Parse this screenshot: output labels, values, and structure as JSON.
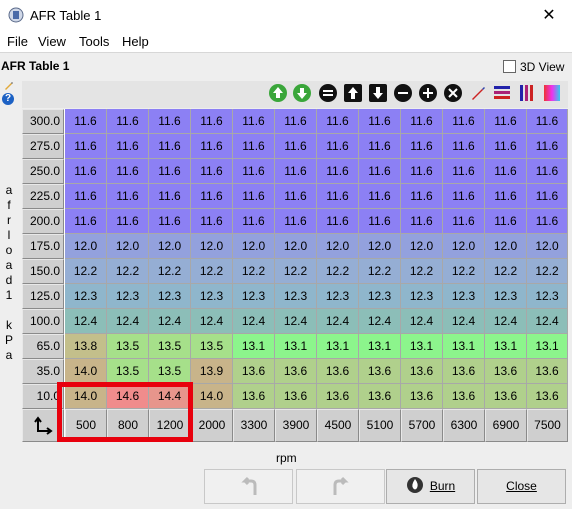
{
  "window": {
    "title": "AFR Table 1",
    "close_glyph": "✕",
    "icon": "wrench-app-icon"
  },
  "menu": [
    "File",
    "View",
    "Tools",
    "Help"
  ],
  "panel": {
    "title": "AFR Table 1",
    "threed_label": "3D View",
    "threed_checked": false
  },
  "toolbar_icons": [
    "green-up-arrow-icon",
    "green-down-arrow-icon",
    "equals-icon",
    "up-arrow-icon",
    "down-arrow-icon",
    "minus-icon",
    "plus-icon",
    "multiply-icon",
    "pencil-icon",
    "horizontal-gradient-icon",
    "vertical-gradient-icon",
    "color-scale-icon"
  ],
  "table": {
    "y_axis_label": "afrload1 kPa",
    "x_axis_label": "rpm",
    "row_headers": [
      "300.0",
      "275.0",
      "250.0",
      "225.0",
      "200.0",
      "175.0",
      "150.0",
      "125.0",
      "100.0",
      "65.0",
      "35.0",
      "10.0"
    ],
    "col_headers": [
      "500",
      "800",
      "1200",
      "2000",
      "3300",
      "3900",
      "4500",
      "5100",
      "5700",
      "6300",
      "6900",
      "7500"
    ],
    "rows": [
      [
        "11.6",
        "11.6",
        "11.6",
        "11.6",
        "11.6",
        "11.6",
        "11.6",
        "11.6",
        "11.6",
        "11.6",
        "11.6",
        "11.6"
      ],
      [
        "11.6",
        "11.6",
        "11.6",
        "11.6",
        "11.6",
        "11.6",
        "11.6",
        "11.6",
        "11.6",
        "11.6",
        "11.6",
        "11.6"
      ],
      [
        "11.6",
        "11.6",
        "11.6",
        "11.6",
        "11.6",
        "11.6",
        "11.6",
        "11.6",
        "11.6",
        "11.6",
        "11.6",
        "11.6"
      ],
      [
        "11.6",
        "11.6",
        "11.6",
        "11.6",
        "11.6",
        "11.6",
        "11.6",
        "11.6",
        "11.6",
        "11.6",
        "11.6",
        "11.6"
      ],
      [
        "11.6",
        "11.6",
        "11.6",
        "11.6",
        "11.6",
        "11.6",
        "11.6",
        "11.6",
        "11.6",
        "11.6",
        "11.6",
        "11.6"
      ],
      [
        "12.0",
        "12.0",
        "12.0",
        "12.0",
        "12.0",
        "12.0",
        "12.0",
        "12.0",
        "12.0",
        "12.0",
        "12.0",
        "12.0"
      ],
      [
        "12.2",
        "12.2",
        "12.2",
        "12.2",
        "12.2",
        "12.2",
        "12.2",
        "12.2",
        "12.2",
        "12.2",
        "12.2",
        "12.2"
      ],
      [
        "12.3",
        "12.3",
        "12.3",
        "12.3",
        "12.3",
        "12.3",
        "12.3",
        "12.3",
        "12.3",
        "12.3",
        "12.3",
        "12.3"
      ],
      [
        "12.4",
        "12.4",
        "12.4",
        "12.4",
        "12.4",
        "12.4",
        "12.4",
        "12.4",
        "12.4",
        "12.4",
        "12.4",
        "12.4"
      ],
      [
        "13.8",
        "13.5",
        "13.5",
        "13.5",
        "13.1",
        "13.1",
        "13.1",
        "13.1",
        "13.1",
        "13.1",
        "13.1",
        "13.1"
      ],
      [
        "14.0",
        "13.5",
        "13.5",
        "13.9",
        "13.6",
        "13.6",
        "13.6",
        "13.6",
        "13.6",
        "13.6",
        "13.6",
        "13.6"
      ],
      [
        "14.0",
        "14.6",
        "14.4",
        "14.0",
        "13.6",
        "13.6",
        "13.6",
        "13.6",
        "13.6",
        "13.6",
        "13.6",
        "13.6"
      ]
    ],
    "highlighted_cells": [
      [
        9,
        0
      ],
      [
        9,
        1
      ],
      [
        9,
        2
      ],
      [
        10,
        0
      ],
      [
        10,
        1
      ],
      [
        10,
        2
      ]
    ],
    "highlight_color": "#e8000d"
  },
  "buttons": {
    "undo": "",
    "redo": "",
    "burn": "Burn",
    "close": "Close"
  },
  "colors": {
    "lean_blue": "#8c80f4",
    "green": "#8cf58c",
    "tan": "#c8b48a",
    "red": "#f08c8c"
  }
}
